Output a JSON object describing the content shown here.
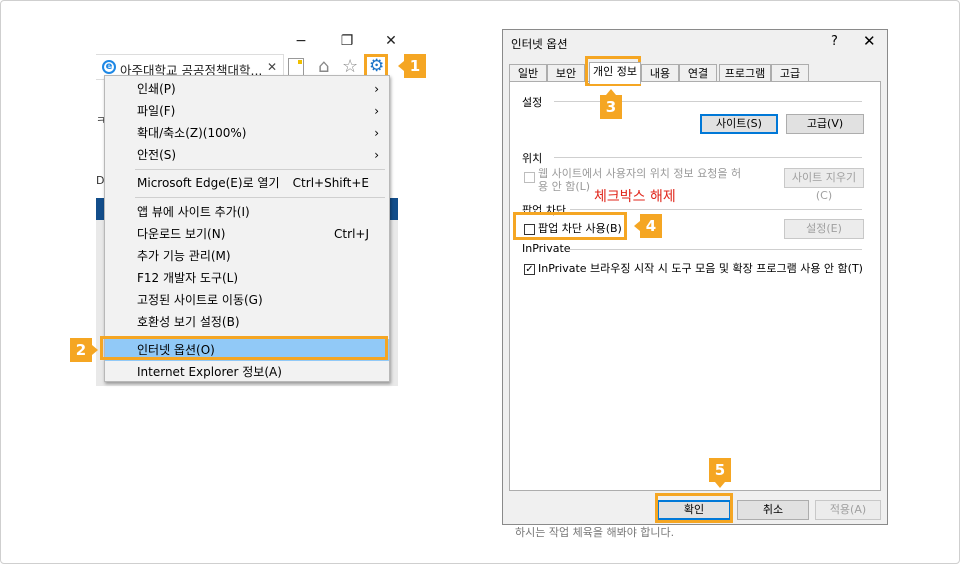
{
  "ie": {
    "tab_title": "아주대학교 공공정책대학...",
    "window_controls": [
      "−",
      "❐",
      "✕"
    ],
    "icons": [
      "home-icon",
      "star-icon",
      "gear-icon"
    ],
    "side_texts": [
      "ㅋ",
      "D"
    ],
    "menu_items": [
      {
        "label": "인쇄(P)",
        "arrow": "›"
      },
      {
        "label": "파일(F)",
        "arrow": "›"
      },
      {
        "label": "확대/축소(Z)(100%)",
        "arrow": "›"
      },
      {
        "label": "안전(S)",
        "arrow": "›"
      },
      {
        "label": "Microsoft Edge(E)로 열기",
        "shortcut": "Ctrl+Shift+E"
      },
      {
        "label": "앱 뷰에 사이트 추가(I)"
      },
      {
        "label": "다운로드 보기(N)",
        "shortcut": "Ctrl+J"
      },
      {
        "label": "추가 기능 관리(M)"
      },
      {
        "label": "F12 개발자 도구(L)"
      },
      {
        "label": "고정된 사이트로 이동(G)"
      },
      {
        "label": "호환성 보기 설정(B)"
      },
      {
        "label": "인터넷 옵션(O)"
      },
      {
        "label": "Internet Explorer 정보(A)"
      }
    ]
  },
  "callouts": [
    "1",
    "2",
    "3",
    "4",
    "5"
  ],
  "dialog": {
    "title": "인터넷 옵션",
    "help": "?",
    "close": "✕",
    "tabs": [
      "일반",
      "보안",
      "개인 정보",
      "내용",
      "연결",
      "프로그램",
      "고급"
    ],
    "active_tab": "개인 정보",
    "settings_group": "설정",
    "sites_button": "사이트(S)",
    "advanced_button": "고급(V)",
    "location_group": "위치",
    "location_check_line1": "웹 사이트에서 사용자의 위치 정보 요청을 허",
    "location_check_line2": "용 안 함(L)",
    "clear_sites_button": "사이트 지우기(C)",
    "popup_group": "팝업 차단",
    "popup_check": "팝업 차단 사용(B)",
    "popup_settings_button": "설정(E)",
    "inprivate_group": "InPrivate",
    "inprivate_check": "InPrivate 브라우징 시작 시 도구 모음 및 확장 프로그램 사용 안 함(T)",
    "ok_button": "확인",
    "cancel_button": "취소",
    "apply_button": "적용(A)"
  },
  "annotation_note": "체크박스 해제",
  "below_text": "하시는 작업 체육을 해봐야 합니다."
}
